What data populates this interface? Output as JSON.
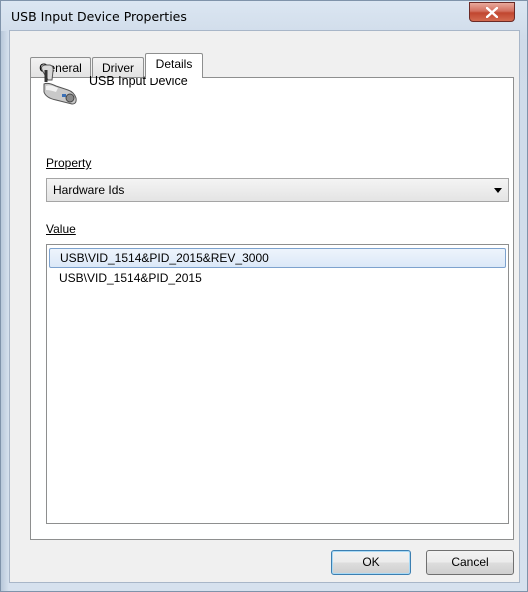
{
  "window": {
    "title": "USB Input Device Properties"
  },
  "tabs": [
    {
      "label": "General"
    },
    {
      "label": "Driver"
    },
    {
      "label": "Details"
    }
  ],
  "device": {
    "name": "USB Input Device",
    "icon": "game-controller-icon"
  },
  "property": {
    "label": "Property",
    "selected": "Hardware Ids"
  },
  "value": {
    "label": "Value",
    "items": [
      "USB\\VID_1514&PID_2015&REV_3000",
      "USB\\VID_1514&PID_2015"
    ]
  },
  "buttons": {
    "ok": "OK",
    "cancel": "Cancel"
  }
}
